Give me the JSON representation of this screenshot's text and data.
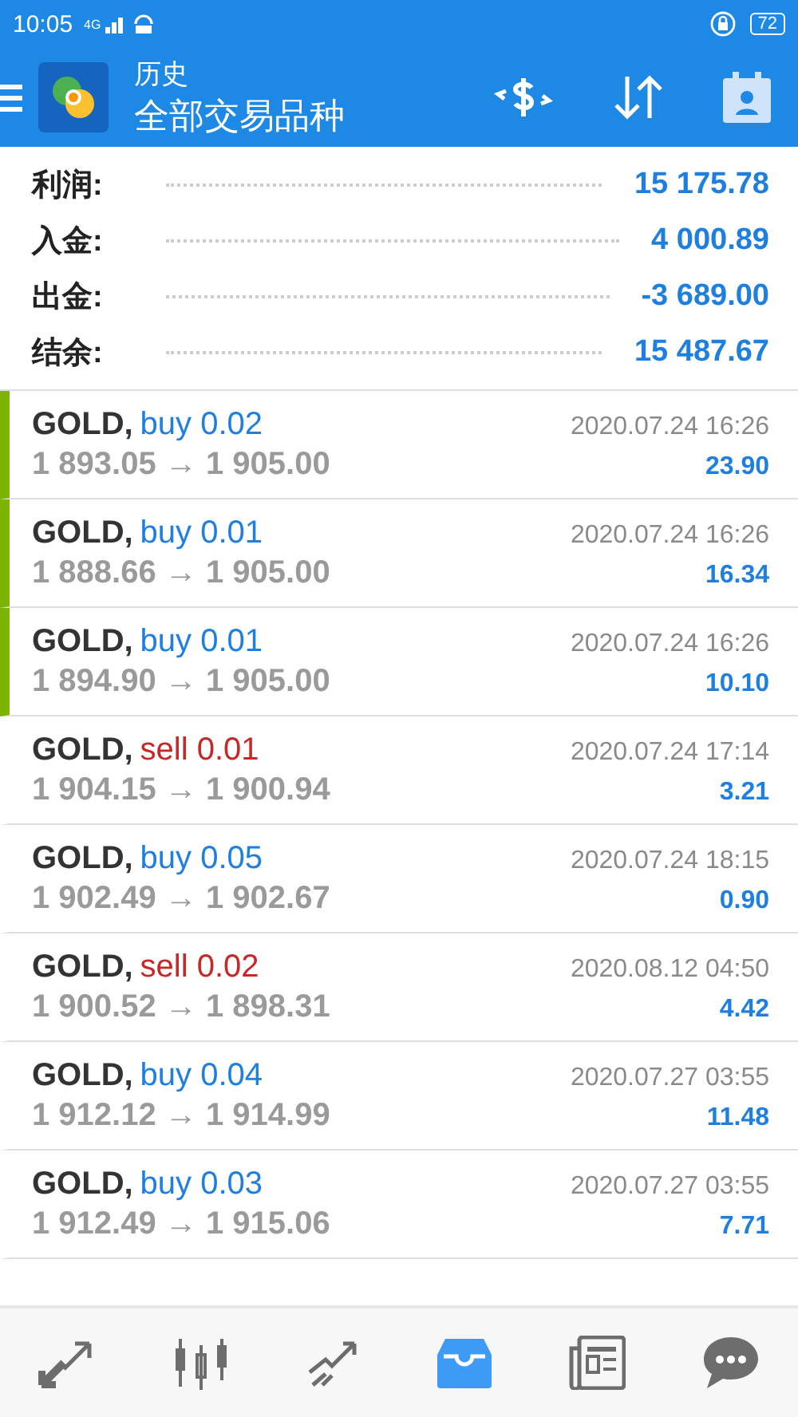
{
  "status_bar": {
    "time": "10:05",
    "network": "4G",
    "battery": "72"
  },
  "header": {
    "subtitle": "历史",
    "title": "全部交易品种"
  },
  "summary": [
    {
      "label": "利润:",
      "value": "15 175.78"
    },
    {
      "label": "入金:",
      "value": "4 000.89"
    },
    {
      "label": "出金:",
      "value": "-3 689.00"
    },
    {
      "label": "结余:",
      "value": "15 487.67"
    }
  ],
  "deals": [
    {
      "symbol": "GOLD,",
      "deal": "buy 0.02",
      "kind": "buy",
      "time": "2020.07.24 16:26",
      "prices": "1 893.05 → 1 905.00",
      "profit": "23.90",
      "marked": true
    },
    {
      "symbol": "GOLD,",
      "deal": "buy 0.01",
      "kind": "buy",
      "time": "2020.07.24 16:26",
      "prices": "1 888.66 → 1 905.00",
      "profit": "16.34",
      "marked": true
    },
    {
      "symbol": "GOLD,",
      "deal": "buy 0.01",
      "kind": "buy",
      "time": "2020.07.24 16:26",
      "prices": "1 894.90 → 1 905.00",
      "profit": "10.10",
      "marked": true
    },
    {
      "symbol": "GOLD,",
      "deal": "sell 0.01",
      "kind": "sell",
      "time": "2020.07.24 17:14",
      "prices": "1 904.15 → 1 900.94",
      "profit": "3.21",
      "marked": false
    },
    {
      "symbol": "GOLD,",
      "deal": "buy 0.05",
      "kind": "buy",
      "time": "2020.07.24 18:15",
      "prices": "1 902.49 → 1 902.67",
      "profit": "0.90",
      "marked": false
    },
    {
      "symbol": "GOLD,",
      "deal": "sell 0.02",
      "kind": "sell",
      "time": "2020.08.12 04:50",
      "prices": "1 900.52 → 1 898.31",
      "profit": "4.42",
      "marked": false
    },
    {
      "symbol": "GOLD,",
      "deal": "buy 0.04",
      "kind": "buy",
      "time": "2020.07.27 03:55",
      "prices": "1 912.12 → 1 914.99",
      "profit": "11.48",
      "marked": false
    },
    {
      "symbol": "GOLD,",
      "deal": "buy 0.03",
      "kind": "buy",
      "time": "2020.07.27 03:55",
      "prices": "1 912.49 → 1 915.06",
      "profit": "7.71",
      "marked": false
    }
  ],
  "nav": [
    {
      "kind": "quotes",
      "selected": false
    },
    {
      "kind": "chart",
      "selected": false
    },
    {
      "kind": "trade",
      "selected": false
    },
    {
      "kind": "history",
      "selected": true
    },
    {
      "kind": "news",
      "selected": false
    },
    {
      "kind": "chat",
      "selected": false
    }
  ]
}
